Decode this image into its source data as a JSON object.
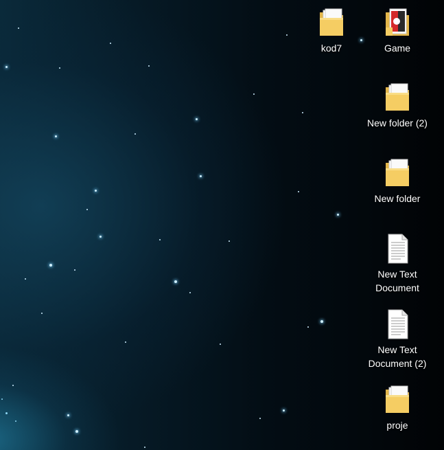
{
  "desktop": {
    "icons": [
      {
        "label": "kod7",
        "icon": "folder-icon"
      },
      {
        "label": "Game",
        "icon": "game-app-icon"
      },
      {
        "label": "New folder (2)",
        "icon": "folder-icon"
      },
      {
        "label": "New folder",
        "icon": "folder-icon"
      },
      {
        "label": "New Text Document",
        "icon": "text-document-icon"
      },
      {
        "label": "New Text Document (2)",
        "icon": "text-document-icon"
      },
      {
        "label": "proje",
        "icon": "folder-icon"
      }
    ]
  }
}
